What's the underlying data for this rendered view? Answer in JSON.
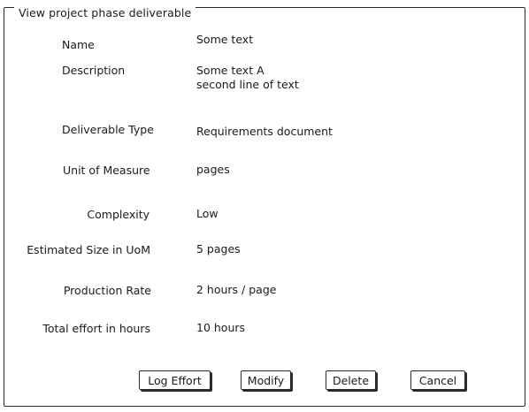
{
  "title": "View project phase deliverable",
  "fields": [
    {
      "label": "Name",
      "value": "Some text"
    },
    {
      "label": "Description",
      "value_lines": [
        "Some text A",
        "second line of text"
      ]
    },
    {
      "label": "Deliverable Type",
      "value": "Requirements document"
    },
    {
      "label": "Unit of Measure",
      "value": "pages"
    },
    {
      "label": "Complexity",
      "value": "Low"
    },
    {
      "label": "Estimated Size in UoM",
      "value": "5 pages"
    },
    {
      "label": "Production Rate",
      "value": "2 hours / page"
    },
    {
      "label": "Total effort in hours",
      "value": "10 hours"
    }
  ],
  "buttons": {
    "log_effort": "Log Effort",
    "modify": "Modify",
    "delete": "Delete",
    "cancel": "Cancel"
  }
}
